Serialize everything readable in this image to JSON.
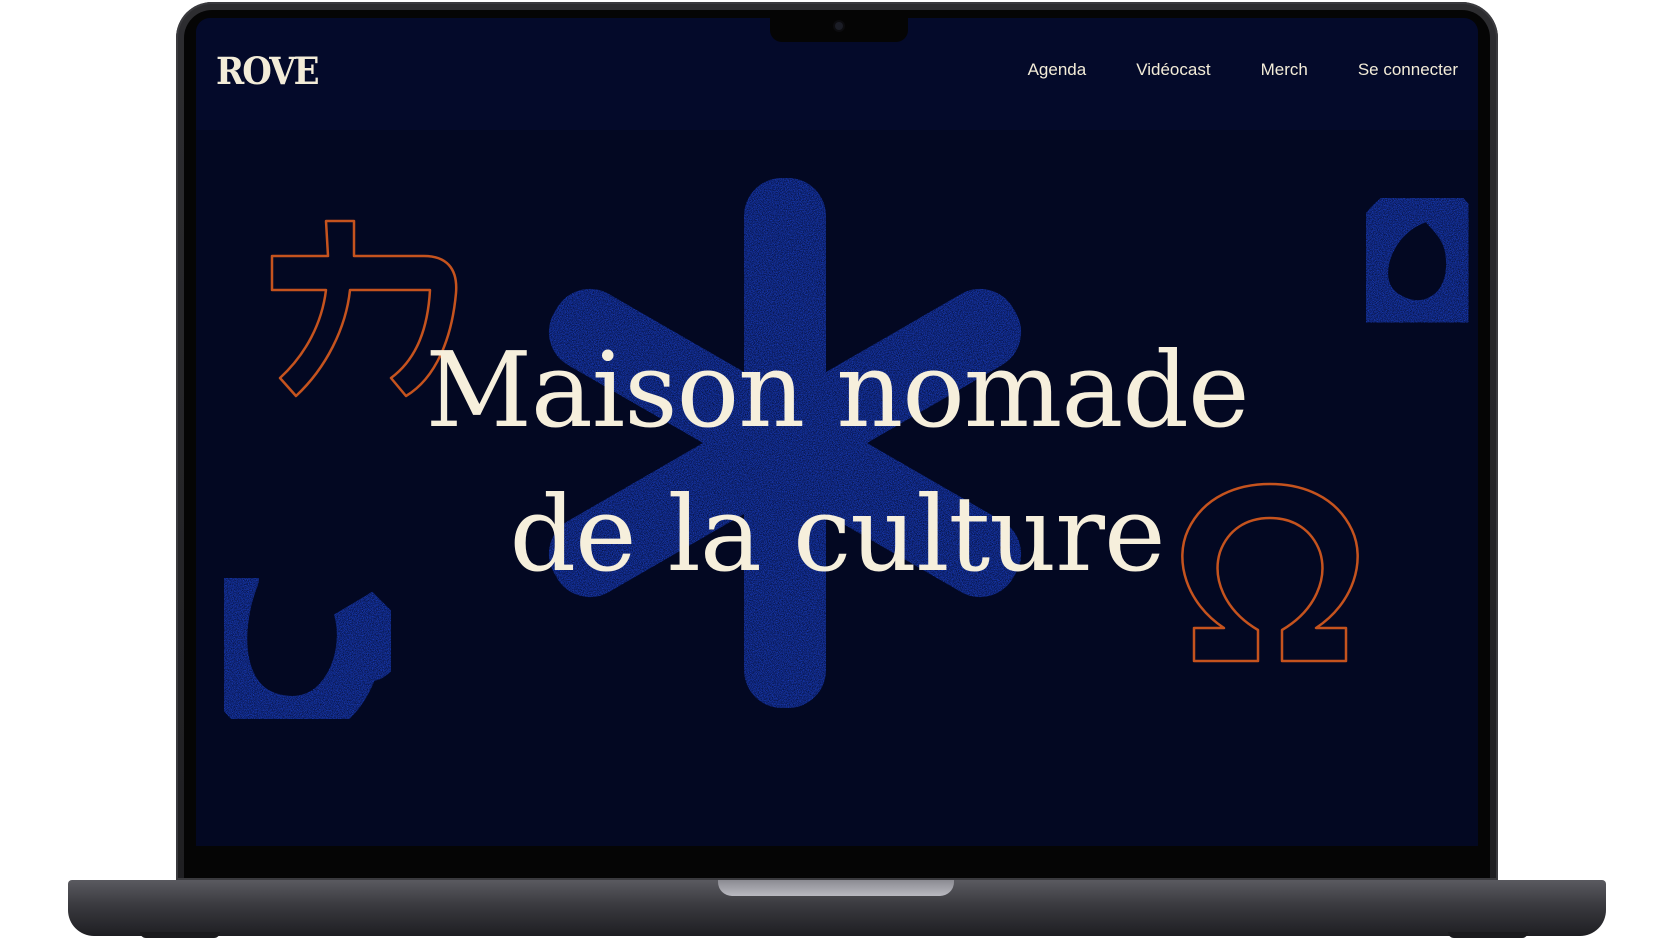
{
  "site": {
    "logo_text": "ROVE"
  },
  "nav": {
    "links": [
      {
        "label": "Agenda"
      },
      {
        "label": "Vidéocast"
      },
      {
        "label": "Merch"
      },
      {
        "label": "Se connecter"
      }
    ]
  },
  "hero": {
    "title_line1": "Maison nomade",
    "title_line2": "de la culture"
  },
  "decorations": {
    "glyph_katakana": "カ",
    "glyph_omega": "Ω",
    "glyph_hiragana": "ひ"
  },
  "colors": {
    "background": "#030822",
    "accent_blue": "#1a3fc4",
    "accent_orange": "#c5531e",
    "text_cream": "#f6efdc"
  }
}
